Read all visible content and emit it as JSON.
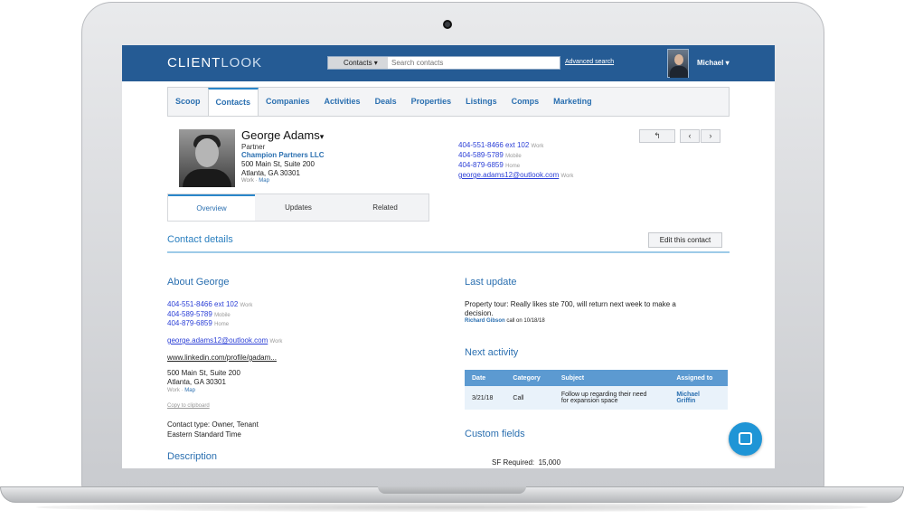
{
  "app": {
    "logo_bold": "CLIENT",
    "logo_thin": "LOOK"
  },
  "search": {
    "scope": "Contacts ▾",
    "placeholder": "Search contacts",
    "advanced": "Advanced search"
  },
  "user": {
    "name": "Michael ▾"
  },
  "nav": {
    "tabs": [
      "Scoop",
      "Contacts",
      "Companies",
      "Activities",
      "Deals",
      "Properties",
      "Listings",
      "Comps",
      "Marketing"
    ],
    "active": "Contacts"
  },
  "contact": {
    "name": "George Adams",
    "caret": "▾",
    "title": "Partner",
    "company": "Champion Partners LLC",
    "address1": "500 Main St, Suite 200",
    "address2": "Atlanta, GA 30301",
    "address_kind": "Work",
    "map_label": "Map",
    "phones": [
      {
        "number": "404-551-8466 ext 102",
        "kind": "Work"
      },
      {
        "number": "404-589-5789",
        "kind": "Mobile"
      },
      {
        "number": "404-879-6859",
        "kind": "Home"
      }
    ],
    "email": "george.adams12@outlook.com",
    "email_kind": "Work"
  },
  "toolbar": {
    "back": "↰",
    "prev": "‹",
    "next": "›"
  },
  "subtabs": [
    "Overview",
    "Updates",
    "Related"
  ],
  "details": {
    "heading": "Contact details",
    "edit_button": "Edit this contact",
    "about_heading": "About George",
    "linkedin": "www.linkedin.com/profile/gadam...",
    "copy": "Copy to clipboard",
    "contact_type": "Contact type: Owner, Tenant",
    "timezone": "Eastern Standard Time",
    "description_heading": "Description"
  },
  "last_update": {
    "heading": "Last update",
    "line1": "Property tour: Really likes ste 700, will return next week to make a",
    "line2": "decision.",
    "author": "Richard Gibson",
    "meta": "call on 10/18/18"
  },
  "next_activity": {
    "heading": "Next activity",
    "columns": [
      "Date",
      "Category",
      "Subject",
      "Assigned to"
    ],
    "rows": [
      {
        "date": "3/21/18",
        "category": "Call",
        "subject1": "Follow up regarding their need",
        "subject2": "for expansion space",
        "assignee1": "Michael",
        "assignee2": "Griffin"
      }
    ]
  },
  "custom_fields": {
    "heading": "Custom fields",
    "sf_label": "SF Required:",
    "sf_value": "15,000"
  }
}
